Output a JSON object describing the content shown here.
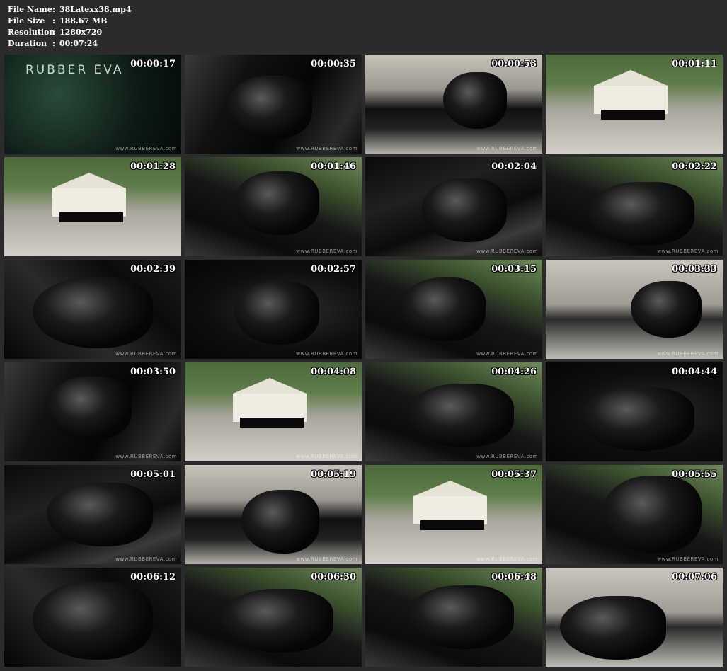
{
  "meta": {
    "file_name_label": "File Name",
    "file_name": "38Latexx38.mp4",
    "file_size_label": "File Size",
    "file_size": "188.67 MB",
    "resolution_label": "Resolution",
    "resolution": "1280x720",
    "duration_label": "Duration",
    "duration": "00:07:24",
    "separator": ":"
  },
  "title_frame_logo": "RUBBER EVA",
  "watermark": "www.RUBBEREVA.com",
  "thumbnails": [
    {
      "time": "00:00:17"
    },
    {
      "time": "00:00:35"
    },
    {
      "time": "00:00:53"
    },
    {
      "time": "00:01:11"
    },
    {
      "time": "00:01:28"
    },
    {
      "time": "00:01:46"
    },
    {
      "time": "00:02:04"
    },
    {
      "time": "00:02:22"
    },
    {
      "time": "00:02:39"
    },
    {
      "time": "00:02:57"
    },
    {
      "time": "00:03:15"
    },
    {
      "time": "00:03:33"
    },
    {
      "time": "00:03:50"
    },
    {
      "time": "00:04:08"
    },
    {
      "time": "00:04:26"
    },
    {
      "time": "00:04:44"
    },
    {
      "time": "00:05:01"
    },
    {
      "time": "00:05:19"
    },
    {
      "time": "00:05:37"
    },
    {
      "time": "00:05:55"
    },
    {
      "time": "00:06:12"
    },
    {
      "time": "00:06:30"
    },
    {
      "time": "00:06:48"
    },
    {
      "time": "00:07:06"
    }
  ]
}
